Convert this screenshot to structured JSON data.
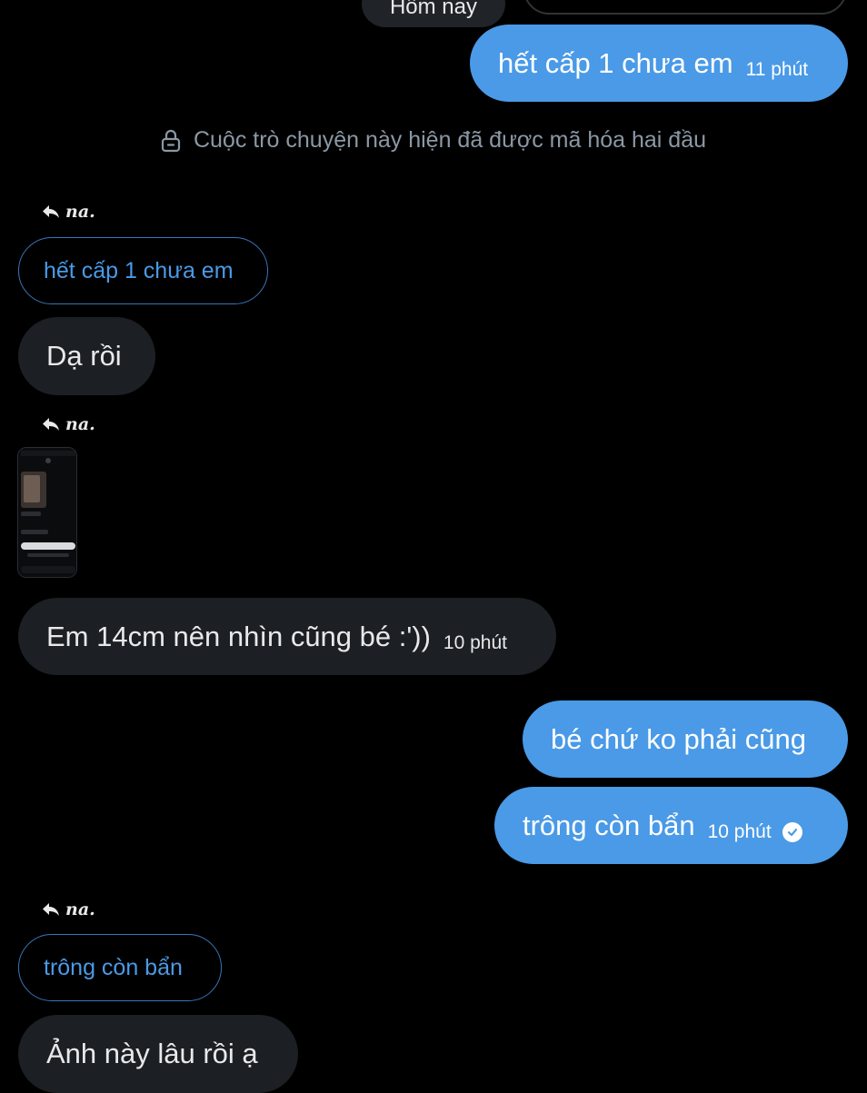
{
  "header": {
    "day_label": "Hôm nay"
  },
  "messages": {
    "m1": {
      "text": "hết cấp 1 chưa em",
      "time": "11 phút"
    },
    "m2": {
      "text": "Dạ rồi"
    },
    "m3": {
      "text": "Em 14cm nên nhìn cũng bé :'))",
      "time": "10 phút"
    },
    "m4": {
      "text": "bé chứ ko phải cũng"
    },
    "m5": {
      "text": "trông còn bẩn",
      "time": "10 phút"
    },
    "m6": {
      "text": "Ảnh này lâu rồi ạ"
    }
  },
  "notice": {
    "encryption": "Cuộc trò chuyện này hiện đã được mã hóa hai đầu"
  },
  "replies": {
    "r1": {
      "name": "𝒏𝒂.",
      "quoted": "hết cấp 1 chưa em"
    },
    "r2": {
      "name": "𝒏𝒂."
    },
    "r3": {
      "name": "𝒏𝒂.",
      "quoted": "trông còn bẩn"
    }
  },
  "colors": {
    "outgoing_bubble": "#4a9ae7",
    "incoming_bubble": "#1c1f23",
    "background": "#000000",
    "muted_text": "#8b98a5"
  },
  "icons": {
    "lock": "lock-icon",
    "reply": "reply-arrow-icon",
    "read": "check-circle-icon"
  }
}
